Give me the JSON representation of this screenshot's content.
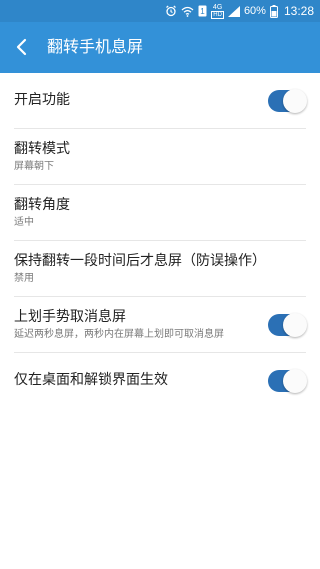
{
  "status_bar": {
    "time": "13:28",
    "battery": "60%",
    "network": "4G",
    "icons": [
      "alarm-icon",
      "wifi-icon",
      "sim-1-icon",
      "4g-hd-icon",
      "signal-icon",
      "battery-icon"
    ]
  },
  "header": {
    "title": "翻转手机息屏",
    "back_icon": "back-arrow-icon"
  },
  "settings": [
    {
      "label": "开启功能",
      "subtitle": "",
      "toggle": true
    },
    {
      "label": "翻转模式",
      "subtitle": "屏幕朝下"
    },
    {
      "label": "翻转角度",
      "subtitle": "适中"
    },
    {
      "label": "保持翻转一段时间后才息屏（防误操作）",
      "subtitle": "禁用"
    },
    {
      "label": "上划手势取消息屏",
      "subtitle": "延迟两秒息屏，两秒内在屏幕上划即可取消息屏",
      "toggle": true
    },
    {
      "label": "仅在桌面和解锁界面生效",
      "subtitle": "",
      "toggle": true
    }
  ],
  "colors": {
    "appbar": "#3391d8",
    "statusbar": "#2f86c9",
    "toggle_on": "#2b70b5"
  }
}
